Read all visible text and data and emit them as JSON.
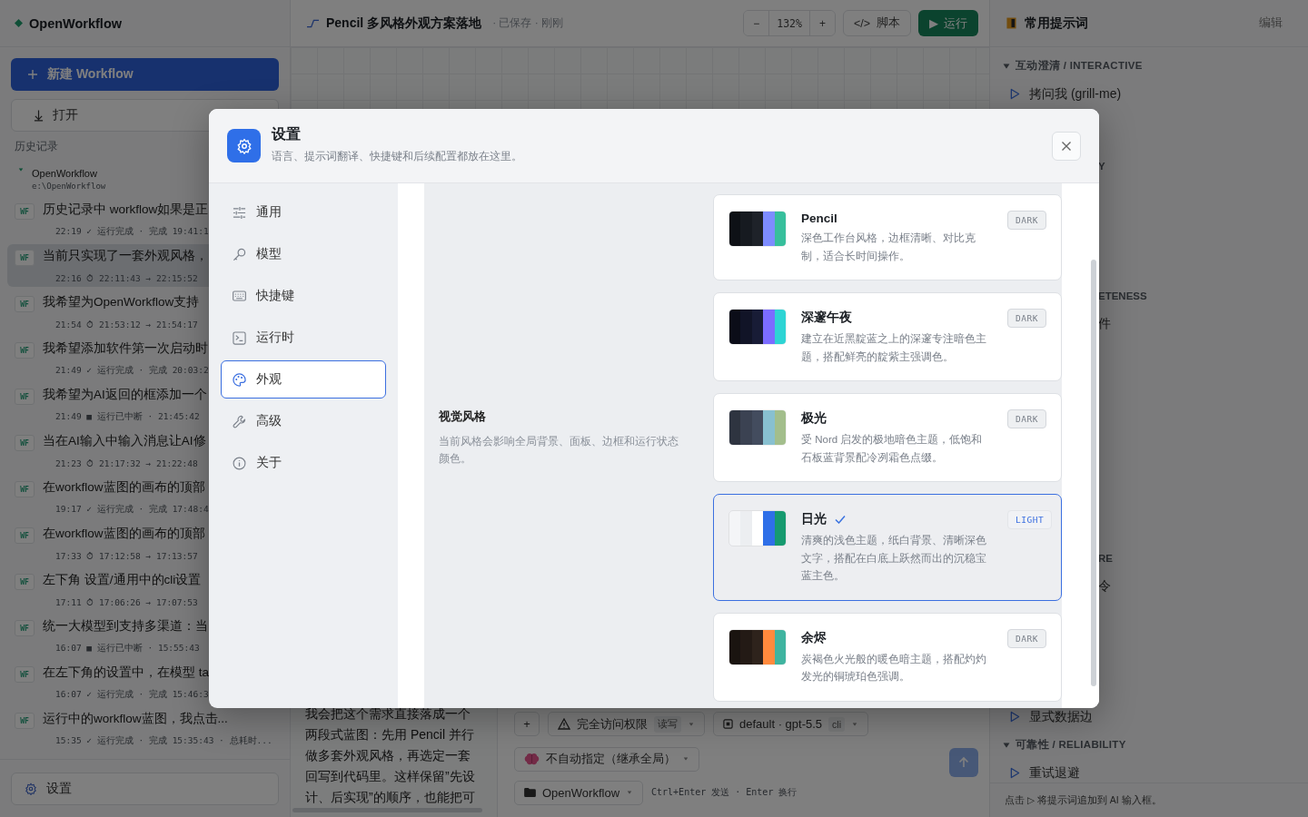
{
  "sidebar": {
    "brand": "OpenWorkflow",
    "new_button": "新建 Workflow",
    "open_button": "打开",
    "history_label": "历史记录",
    "project": {
      "name": "OpenWorkflow",
      "path": "e:\\OpenWorkflow",
      "expanded": true
    },
    "history": [
      {
        "badge": "WF",
        "title": "历史记录中 workflow如果是正",
        "meta": "22:19 ✓ 运行完成 · 完成 19:41:1",
        "selected": false
      },
      {
        "badge": "WF",
        "title": "当前只实现了一套外观风格，",
        "meta": "22:16 ⏱ 22:11:43 → 22:15:52",
        "selected": true
      },
      {
        "badge": "WF",
        "title": "我希望为OpenWorkflow支持",
        "meta": "21:54 ⏱ 21:53:12 → 21:54:17",
        "selected": false
      },
      {
        "badge": "WF",
        "title": "我希望添加软件第一次启动时",
        "meta": "21:49 ✓ 运行完成 · 完成 20:03:2",
        "selected": false
      },
      {
        "badge": "WF",
        "title": "我希望为AI返回的框添加一个",
        "meta": "21:49 ■ 运行已中断 · 21:45:42",
        "selected": false
      },
      {
        "badge": "WF",
        "title": "当在AI输入中输入消息让AI修",
        "meta": "21:23 ⏱ 21:17:32 → 21:22:48",
        "selected": false
      },
      {
        "badge": "WF",
        "title": "在workflow蓝图的画布的顶部",
        "meta": "19:17 ✓ 运行完成 · 完成 17:48:4",
        "selected": false
      },
      {
        "badge": "WF",
        "title": "在workflow蓝图的画布的顶部",
        "meta": "17:33 ⏱ 17:12:58 → 17:13:57",
        "selected": false
      },
      {
        "badge": "WF",
        "title": "左下角 设置/通用中的cli设置",
        "meta": "17:11 ⏱ 17:06:26 → 17:07:53",
        "selected": false
      },
      {
        "badge": "WF",
        "title": "统一大模型到支持多渠道：当",
        "meta": "16:07 ■ 运行已中断 · 15:55:43",
        "selected": false
      },
      {
        "badge": "WF",
        "title": "在左下角的设置中，在模型 ta",
        "meta": "16:07 ✓ 运行完成 · 完成 15:46:3",
        "selected": false
      },
      {
        "badge": "WF",
        "title": "运行中的workflow蓝图，我点击...",
        "meta": "15:35 ✓ 运行完成 · 完成 15:35:43 · 总耗时...",
        "selected": false
      }
    ],
    "settings_button": "设置"
  },
  "editor": {
    "title": "Pencil 多风格外观方案落地",
    "status": "· 已保存 · 刚刚",
    "zoom_out": "−",
    "zoom": "132%",
    "zoom_in": "+",
    "script_glyph": "</>",
    "script_button": "脚本",
    "run_glyph": "▶",
    "run_button": "运行"
  },
  "chat": {
    "message": "我会把这个需求直接落成一个两段式蓝图：先用 Pencil 并行做多套外观风格，再选定一套回写到代码里。这样保留”先设计、后实现”的顺序，也能把可",
    "composer": {
      "add": "+",
      "access": {
        "label": "完全访问权限",
        "tag": "读写"
      },
      "model": {
        "label": "default · gpt-5.5",
        "tag": "cli"
      },
      "reasoning": "不自动指定（继承全局）",
      "project": "OpenWorkflow",
      "hint": "Ctrl+Enter 发送 · Enter 换行"
    }
  },
  "prompts": {
    "title": "常用提示词",
    "edit": "编辑",
    "rows": [
      {
        "kind": "heading",
        "text": "互动澄清 / INTERACTIVE",
        "expanded": true
      },
      {
        "kind": "item",
        "text": "拷问我 (grill-me)"
      },
      {
        "kind": "fragment",
        "text": "Y"
      },
      {
        "kind": "fragment",
        "text": "ETENESS"
      },
      {
        "kind": "fragment-item",
        "text": "件"
      },
      {
        "kind": "fragment",
        "text": "RE"
      },
      {
        "kind": "fragment-item",
        "text": "令"
      },
      {
        "kind": "item",
        "text": "显式数据边"
      },
      {
        "kind": "heading",
        "text": "可靠性 / RELIABILITY",
        "expanded": true
      },
      {
        "kind": "item",
        "text": "重试退避"
      }
    ],
    "footer": "点击 ▷ 将提示词追加到 AI 输入框。"
  },
  "settings": {
    "title": "设置",
    "subtitle": "语言、提示词翻译、快捷键和后续配置都放在这里。",
    "nav": [
      {
        "kind": "sliders",
        "label": "通用",
        "selected": false
      },
      {
        "kind": "key",
        "label": "模型",
        "selected": false
      },
      {
        "kind": "keyboard",
        "label": "快捷键",
        "selected": false
      },
      {
        "kind": "terminal",
        "label": "运行时",
        "selected": false
      },
      {
        "kind": "palette",
        "label": "外观",
        "selected": true
      },
      {
        "kind": "wrench",
        "label": "高级",
        "selected": false
      },
      {
        "kind": "info",
        "label": "关于",
        "selected": false
      }
    ],
    "section": {
      "label": "视觉风格",
      "description": "当前风格会影响全局背景、面板、边框和运行状态颜色。"
    },
    "themes": [
      {
        "name": "Pencil",
        "description": "深色工作台风格，边框清晰、对比克制，适合长时间操作。",
        "badge": "DARK",
        "selected": false,
        "swatches": [
          {
            "color": "#0e1116"
          },
          {
            "color": "#161a20"
          },
          {
            "color": "#1e2229"
          },
          {
            "color": "#7d8cff"
          },
          {
            "color": "#37bf9c"
          }
        ]
      },
      {
        "name": "深邃午夜",
        "description": "建立在近黑靛蓝之上的深邃专注暗色主题，搭配鲜亮的靛紫主强调色。",
        "badge": "DARK",
        "selected": false,
        "swatches": [
          {
            "color": "#0b0d18"
          },
          {
            "color": "#111427"
          },
          {
            "color": "#181c36"
          },
          {
            "color": "#7b6cff"
          },
          {
            "color": "#2dd4d4"
          }
        ]
      },
      {
        "name": "极光",
        "description": "受 Nord 启发的极地暗色主题，低饱和石板蓝背景配冷冽霜色点缀。",
        "badge": "DARK",
        "selected": false,
        "swatches": [
          {
            "color": "#2e3440"
          },
          {
            "color": "#3b4252"
          },
          {
            "color": "#434c5e"
          },
          {
            "color": "#88c0d0"
          },
          {
            "color": "#a3be8c"
          }
        ]
      },
      {
        "name": "日光",
        "description": "清爽的浅色主题，纸白背景、清晰深色文字，搭配在白底上跃然而出的沉稳宝蓝主色。",
        "badge": "LIGHT",
        "selected": true,
        "swatches": [
          {
            "color": "#f4f5f7"
          },
          {
            "color": "#eceef1"
          },
          {
            "color": "#ffffff"
          },
          {
            "color": "#2f6fe8"
          },
          {
            "color": "#169a6f"
          }
        ]
      },
      {
        "name": "余烬",
        "description": "炭褐色火光般的暖色暗主题，搭配灼灼发光的铜琥珀色强调。",
        "badge": "DARK",
        "selected": false,
        "swatches": [
          {
            "color": "#1a1410"
          },
          {
            "color": "#231a15"
          },
          {
            "color": "#2e231c"
          },
          {
            "color": "#ff8a3d"
          },
          {
            "color": "#3fb4a0"
          }
        ]
      }
    ]
  }
}
